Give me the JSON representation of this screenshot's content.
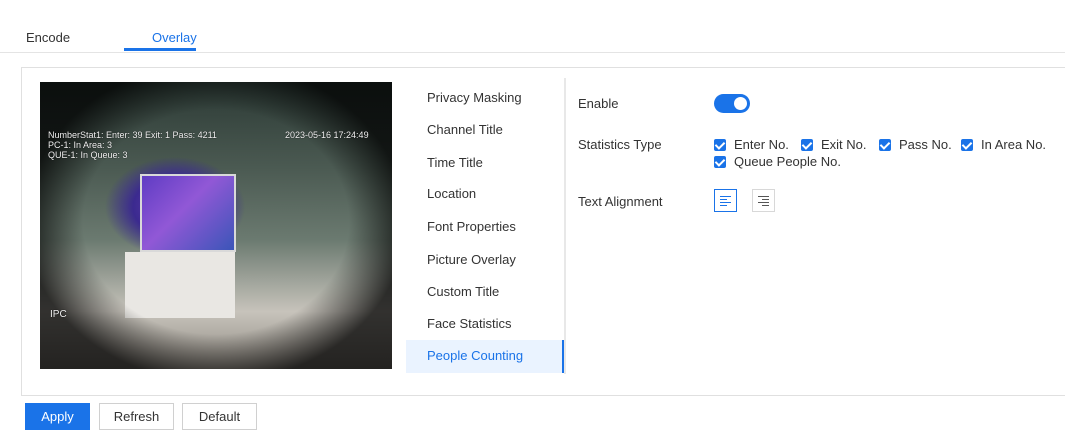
{
  "tabs": [
    {
      "label": "Encode"
    },
    {
      "label": "Overlay"
    }
  ],
  "video": {
    "osd_line1": "NumberStat1: Enter: 39 Exit: 1  Pass: 4211",
    "osd_line2": "PC-1: In Area: 3",
    "osd_line3": "QUE-1: In Queue: 3",
    "timestamp": "2023-05-16 17:24:49",
    "device_label": "IPC"
  },
  "menu": {
    "items": [
      {
        "label": "Privacy Masking"
      },
      {
        "label": "Channel Title"
      },
      {
        "label": "Time Title"
      },
      {
        "label": "Location"
      },
      {
        "label": "Font Properties"
      },
      {
        "label": "Picture Overlay"
      },
      {
        "label": "Custom Title"
      },
      {
        "label": "Face Statistics"
      },
      {
        "label": "People Counting"
      }
    ],
    "active": "People Counting"
  },
  "form": {
    "enable_label": "Enable",
    "enable_value": true,
    "stats_type_label": "Statistics Type",
    "stats_options": [
      {
        "label": "Enter No.",
        "checked": true
      },
      {
        "label": "Exit No.",
        "checked": true
      },
      {
        "label": "Pass No.",
        "checked": true
      },
      {
        "label": "In Area No.",
        "checked": true
      },
      {
        "label": "Queue People No.",
        "checked": true
      }
    ],
    "text_alignment_label": "Text Alignment",
    "alignment_options": [
      "left-align-icon",
      "right-align-icon"
    ],
    "alignment_selected": "left-align-icon"
  },
  "buttons": {
    "apply": "Apply",
    "refresh": "Refresh",
    "default": "Default"
  },
  "colors": {
    "accent": "#1a73e8"
  }
}
